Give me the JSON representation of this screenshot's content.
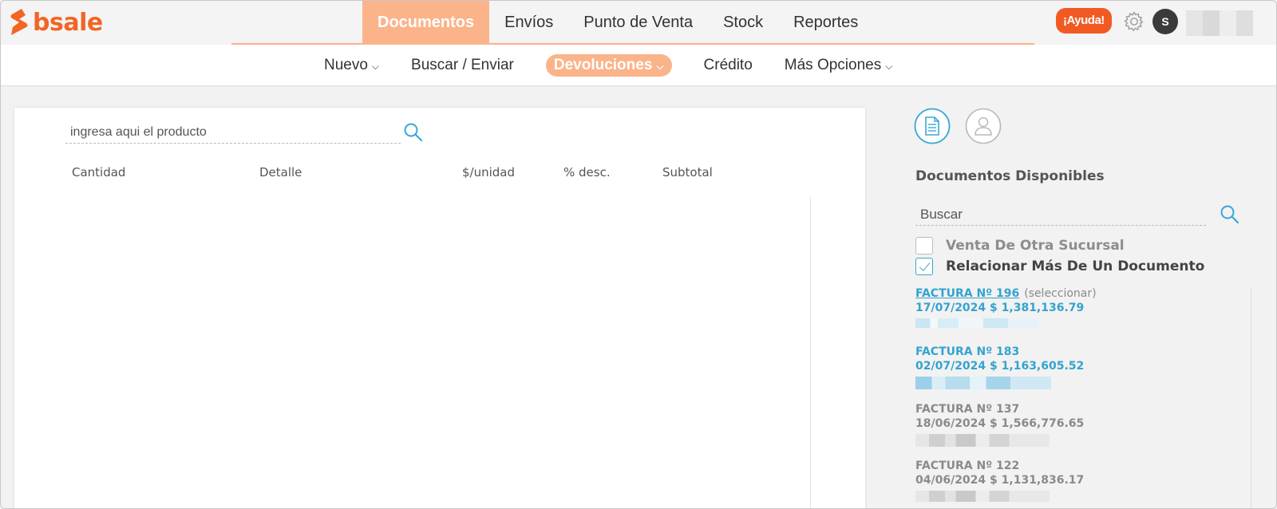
{
  "brand": {
    "name": "bsale",
    "primary_color": "#f26524",
    "nav_active_color": "#fbb38a"
  },
  "main_nav": {
    "items": [
      {
        "label": "Documentos",
        "active": true
      },
      {
        "label": "Envíos",
        "active": false
      },
      {
        "label": "Punto de Venta",
        "active": false
      },
      {
        "label": "Stock",
        "active": false
      },
      {
        "label": "Reportes",
        "active": false
      }
    ]
  },
  "header_right": {
    "help_label": "¡Ayuda!",
    "settings_icon": "gear-icon",
    "avatar_initial": "S"
  },
  "sub_nav": {
    "items": [
      {
        "label": "Nuevo",
        "has_dropdown": true,
        "active": false
      },
      {
        "label": "Buscar / Enviar",
        "has_dropdown": false,
        "active": false
      },
      {
        "label": "Devoluciones",
        "has_dropdown": true,
        "active": true
      },
      {
        "label": "Crédito",
        "has_dropdown": false,
        "active": false
      },
      {
        "label": "Más Opciones",
        "has_dropdown": true,
        "active": false
      }
    ]
  },
  "product_search": {
    "placeholder": "ingresa aqui el producto",
    "value": ""
  },
  "table": {
    "columns": [
      "Cantidad",
      "Detalle",
      "$/unidad",
      "% desc.",
      "Subtotal"
    ],
    "rows": []
  },
  "right_panel": {
    "tab_icons": [
      "document-icon",
      "user-icon"
    ],
    "title": "Documentos Disponibles",
    "search_placeholder": "Buscar",
    "search_value": "",
    "checkboxes": [
      {
        "label": "Venta De Otra Sucursal",
        "checked": false
      },
      {
        "label": "Relacionar Más De Un Documento",
        "checked": true
      }
    ],
    "documents": [
      {
        "title": "FACTURA Nº 196",
        "action": "(seleccionar)",
        "date_amount": "17/07/2024 $ 1,381,136.79",
        "style": "blue"
      },
      {
        "title": "FACTURA Nº 183",
        "action": "",
        "date_amount": "02/07/2024 $ 1,163,605.52",
        "style": "blue"
      },
      {
        "title": "FACTURA Nº 137",
        "action": "",
        "date_amount": "18/06/2024 $ 1,566,776.65",
        "style": "gray"
      },
      {
        "title": "FACTURA Nº 122",
        "action": "",
        "date_amount": "04/06/2024 $ 1,131,836.17",
        "style": "gray"
      }
    ]
  }
}
